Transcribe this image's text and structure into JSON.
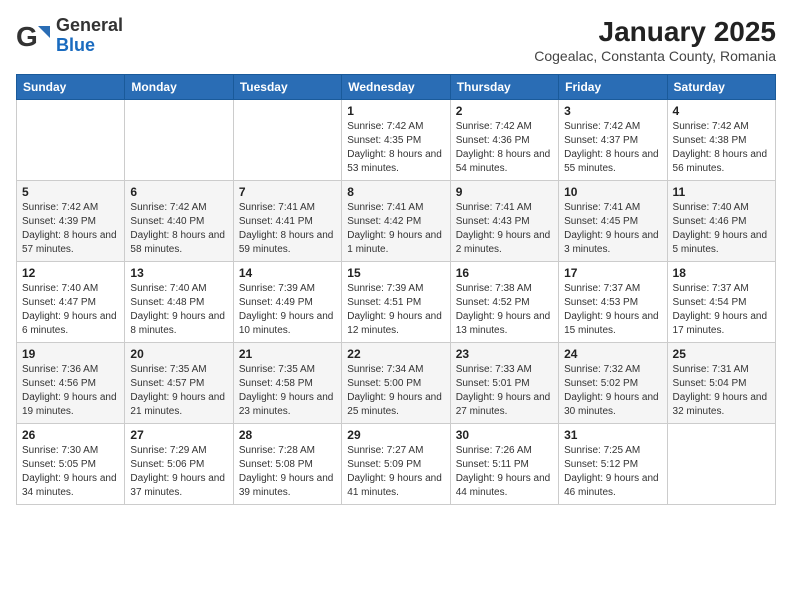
{
  "header": {
    "logo_general": "General",
    "logo_blue": "Blue",
    "title": "January 2025",
    "subtitle": "Cogealac, Constanta County, Romania"
  },
  "weekdays": [
    "Sunday",
    "Monday",
    "Tuesday",
    "Wednesday",
    "Thursday",
    "Friday",
    "Saturday"
  ],
  "weeks": [
    [
      {
        "day": "",
        "sunrise": "",
        "sunset": "",
        "daylight": ""
      },
      {
        "day": "",
        "sunrise": "",
        "sunset": "",
        "daylight": ""
      },
      {
        "day": "",
        "sunrise": "",
        "sunset": "",
        "daylight": ""
      },
      {
        "day": "1",
        "sunrise": "Sunrise: 7:42 AM",
        "sunset": "Sunset: 4:35 PM",
        "daylight": "Daylight: 8 hours and 53 minutes."
      },
      {
        "day": "2",
        "sunrise": "Sunrise: 7:42 AM",
        "sunset": "Sunset: 4:36 PM",
        "daylight": "Daylight: 8 hours and 54 minutes."
      },
      {
        "day": "3",
        "sunrise": "Sunrise: 7:42 AM",
        "sunset": "Sunset: 4:37 PM",
        "daylight": "Daylight: 8 hours and 55 minutes."
      },
      {
        "day": "4",
        "sunrise": "Sunrise: 7:42 AM",
        "sunset": "Sunset: 4:38 PM",
        "daylight": "Daylight: 8 hours and 56 minutes."
      }
    ],
    [
      {
        "day": "5",
        "sunrise": "Sunrise: 7:42 AM",
        "sunset": "Sunset: 4:39 PM",
        "daylight": "Daylight: 8 hours and 57 minutes."
      },
      {
        "day": "6",
        "sunrise": "Sunrise: 7:42 AM",
        "sunset": "Sunset: 4:40 PM",
        "daylight": "Daylight: 8 hours and 58 minutes."
      },
      {
        "day": "7",
        "sunrise": "Sunrise: 7:41 AM",
        "sunset": "Sunset: 4:41 PM",
        "daylight": "Daylight: 8 hours and 59 minutes."
      },
      {
        "day": "8",
        "sunrise": "Sunrise: 7:41 AM",
        "sunset": "Sunset: 4:42 PM",
        "daylight": "Daylight: 9 hours and 1 minute."
      },
      {
        "day": "9",
        "sunrise": "Sunrise: 7:41 AM",
        "sunset": "Sunset: 4:43 PM",
        "daylight": "Daylight: 9 hours and 2 minutes."
      },
      {
        "day": "10",
        "sunrise": "Sunrise: 7:41 AM",
        "sunset": "Sunset: 4:45 PM",
        "daylight": "Daylight: 9 hours and 3 minutes."
      },
      {
        "day": "11",
        "sunrise": "Sunrise: 7:40 AM",
        "sunset": "Sunset: 4:46 PM",
        "daylight": "Daylight: 9 hours and 5 minutes."
      }
    ],
    [
      {
        "day": "12",
        "sunrise": "Sunrise: 7:40 AM",
        "sunset": "Sunset: 4:47 PM",
        "daylight": "Daylight: 9 hours and 6 minutes."
      },
      {
        "day": "13",
        "sunrise": "Sunrise: 7:40 AM",
        "sunset": "Sunset: 4:48 PM",
        "daylight": "Daylight: 9 hours and 8 minutes."
      },
      {
        "day": "14",
        "sunrise": "Sunrise: 7:39 AM",
        "sunset": "Sunset: 4:49 PM",
        "daylight": "Daylight: 9 hours and 10 minutes."
      },
      {
        "day": "15",
        "sunrise": "Sunrise: 7:39 AM",
        "sunset": "Sunset: 4:51 PM",
        "daylight": "Daylight: 9 hours and 12 minutes."
      },
      {
        "day": "16",
        "sunrise": "Sunrise: 7:38 AM",
        "sunset": "Sunset: 4:52 PM",
        "daylight": "Daylight: 9 hours and 13 minutes."
      },
      {
        "day": "17",
        "sunrise": "Sunrise: 7:37 AM",
        "sunset": "Sunset: 4:53 PM",
        "daylight": "Daylight: 9 hours and 15 minutes."
      },
      {
        "day": "18",
        "sunrise": "Sunrise: 7:37 AM",
        "sunset": "Sunset: 4:54 PM",
        "daylight": "Daylight: 9 hours and 17 minutes."
      }
    ],
    [
      {
        "day": "19",
        "sunrise": "Sunrise: 7:36 AM",
        "sunset": "Sunset: 4:56 PM",
        "daylight": "Daylight: 9 hours and 19 minutes."
      },
      {
        "day": "20",
        "sunrise": "Sunrise: 7:35 AM",
        "sunset": "Sunset: 4:57 PM",
        "daylight": "Daylight: 9 hours and 21 minutes."
      },
      {
        "day": "21",
        "sunrise": "Sunrise: 7:35 AM",
        "sunset": "Sunset: 4:58 PM",
        "daylight": "Daylight: 9 hours and 23 minutes."
      },
      {
        "day": "22",
        "sunrise": "Sunrise: 7:34 AM",
        "sunset": "Sunset: 5:00 PM",
        "daylight": "Daylight: 9 hours and 25 minutes."
      },
      {
        "day": "23",
        "sunrise": "Sunrise: 7:33 AM",
        "sunset": "Sunset: 5:01 PM",
        "daylight": "Daylight: 9 hours and 27 minutes."
      },
      {
        "day": "24",
        "sunrise": "Sunrise: 7:32 AM",
        "sunset": "Sunset: 5:02 PM",
        "daylight": "Daylight: 9 hours and 30 minutes."
      },
      {
        "day": "25",
        "sunrise": "Sunrise: 7:31 AM",
        "sunset": "Sunset: 5:04 PM",
        "daylight": "Daylight: 9 hours and 32 minutes."
      }
    ],
    [
      {
        "day": "26",
        "sunrise": "Sunrise: 7:30 AM",
        "sunset": "Sunset: 5:05 PM",
        "daylight": "Daylight: 9 hours and 34 minutes."
      },
      {
        "day": "27",
        "sunrise": "Sunrise: 7:29 AM",
        "sunset": "Sunset: 5:06 PM",
        "daylight": "Daylight: 9 hours and 37 minutes."
      },
      {
        "day": "28",
        "sunrise": "Sunrise: 7:28 AM",
        "sunset": "Sunset: 5:08 PM",
        "daylight": "Daylight: 9 hours and 39 minutes."
      },
      {
        "day": "29",
        "sunrise": "Sunrise: 7:27 AM",
        "sunset": "Sunset: 5:09 PM",
        "daylight": "Daylight: 9 hours and 41 minutes."
      },
      {
        "day": "30",
        "sunrise": "Sunrise: 7:26 AM",
        "sunset": "Sunset: 5:11 PM",
        "daylight": "Daylight: 9 hours and 44 minutes."
      },
      {
        "day": "31",
        "sunrise": "Sunrise: 7:25 AM",
        "sunset": "Sunset: 5:12 PM",
        "daylight": "Daylight: 9 hours and 46 minutes."
      },
      {
        "day": "",
        "sunrise": "",
        "sunset": "",
        "daylight": ""
      }
    ]
  ]
}
